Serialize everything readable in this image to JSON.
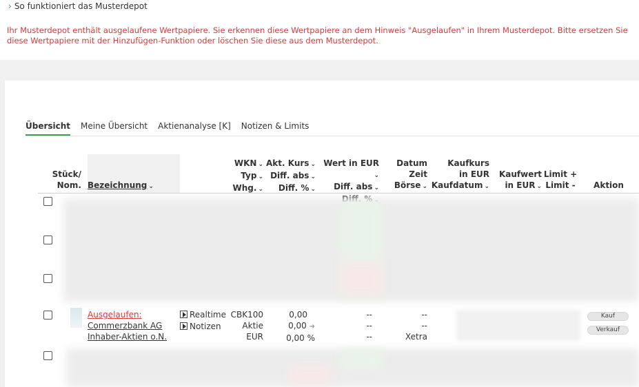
{
  "header": {
    "howto_label": "So funktioniert das Musterdepot",
    "warning": "Ihr Musterdepot enthält ausgelaufene Wertpapiere. Sie erkennen diese Wertpapiere an dem Hinweis \"Ausgelaufen\" in Ihrem Musterdepot. Bitte ersetzen Sie diese Wertpapiere mit der Hinzufügen-Funktion oder löschen Sie diese aus dem Musterdepot."
  },
  "tabs": [
    {
      "label": "Übersicht",
      "active": true
    },
    {
      "label": "Meine Übersicht",
      "active": false
    },
    {
      "label": "Aktienanalyse [K]",
      "active": false
    },
    {
      "label": "Notizen & Limits",
      "active": false
    }
  ],
  "columns": {
    "stueck": [
      "Stück/",
      "Nom."
    ],
    "bezeichnung": "Bezeichnung",
    "wkn": [
      "WKN",
      "Typ",
      "Whg."
    ],
    "kurs": [
      "Akt. Kurs",
      "Diff. abs",
      "Diff. %"
    ],
    "wert": [
      "Wert in EUR",
      "Diff. abs",
      "Diff. %"
    ],
    "datum": [
      "Datum",
      "Zeit",
      "Börse"
    ],
    "kaufkurs": [
      "Kaufkurs",
      "in EUR",
      "Kaufdatum"
    ],
    "kaufwert": [
      "Kaufwert",
      "in EUR"
    ],
    "limit": [
      "Limit +",
      "Limit -"
    ],
    "aktion": "Aktion"
  },
  "expired_row": {
    "status": "Ausgelaufen:",
    "name_line1": "Commerzbank AG",
    "name_line2": "Inhaber-Aktien o.N.",
    "realtime": "Realtime",
    "notizen": "Notizen",
    "wkn": "CBK100",
    "typ": "Aktie",
    "whg": "EUR",
    "kurs": "0,00",
    "diff_abs": "0,00",
    "diff_pct": "0,00 %",
    "wert": "--",
    "wert_diff_abs": "--",
    "wert_diff_pct": "--",
    "datum": "--",
    "zeit": "--",
    "boerse": "Xetra",
    "kauf_label": "Kauf",
    "verkauf_label": "Verkauf"
  },
  "colors": {
    "accent": "#3aa04a",
    "warning": "#d23c3c"
  }
}
